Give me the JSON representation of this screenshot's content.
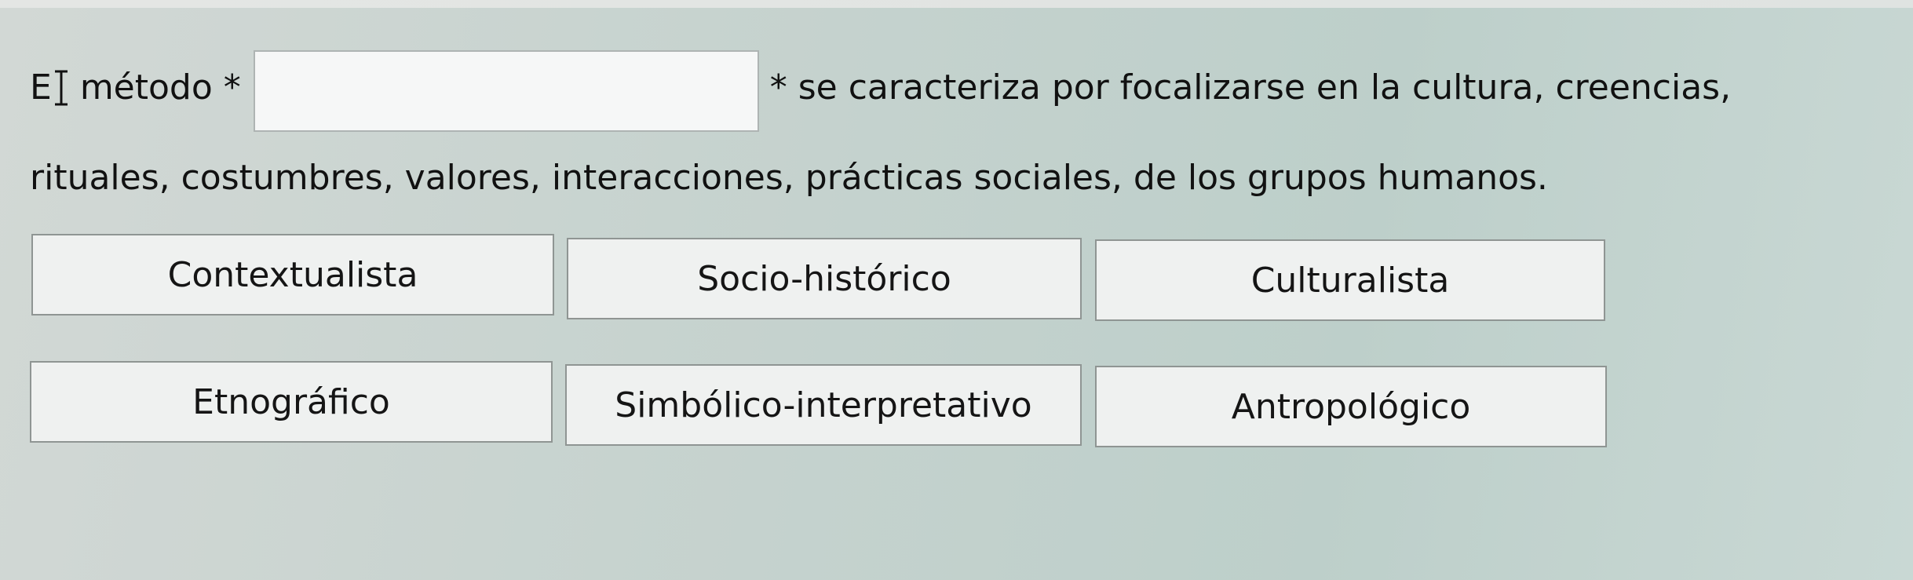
{
  "question": {
    "start_letter": "E",
    "word_before_blank": "método *",
    "after_blank": "* se caracteriza por focalizarse en la cultura, creencias,",
    "line2": "rituales, costumbres, valores, interacciones, prácticas sociales, de los grupos humanos.",
    "blank_value": ""
  },
  "options": [
    {
      "label": "Contextualista"
    },
    {
      "label": "Socio-histórico"
    },
    {
      "label": "Culturalista"
    },
    {
      "label": "Etnográfico"
    },
    {
      "label": "Simbólico-interpretativo"
    },
    {
      "label": "Antropológico"
    }
  ],
  "icons": {
    "text_cursor": "text-cursor-icon"
  },
  "colors": {
    "background": "#c7d3cf",
    "option_fill": "#eff1f0",
    "option_border": "#8f9593",
    "blank_fill": "#f6f7f7"
  }
}
